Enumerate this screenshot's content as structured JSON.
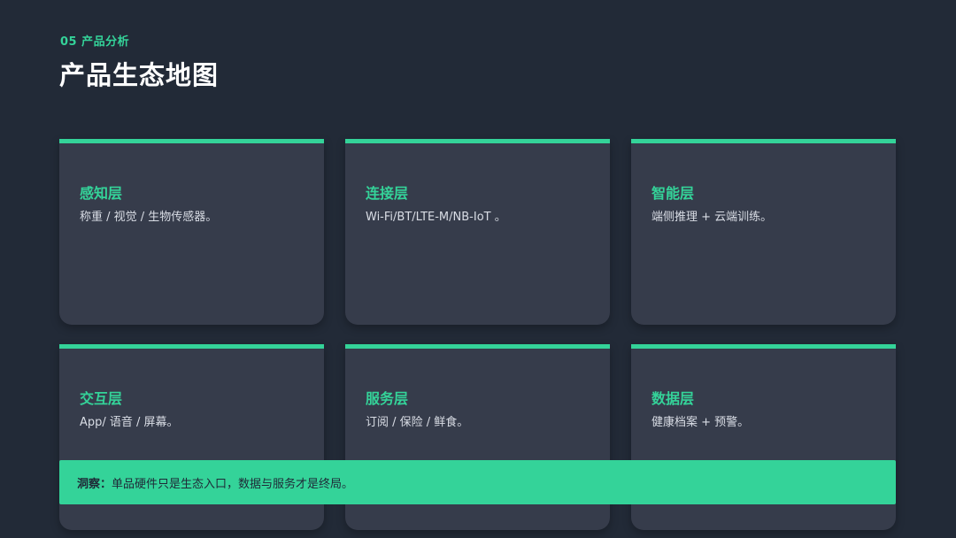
{
  "header": {
    "section": "05 产品分析",
    "title": "产品生态地图"
  },
  "cards": [
    {
      "title": "感知层",
      "desc": "称重 / 视觉 / 生物传感器。"
    },
    {
      "title": "连接层",
      "desc": "Wi-Fi/BT/LTE-M/NB-IoT 。"
    },
    {
      "title": "智能层",
      "desc": "端侧推理 + 云端训练。"
    },
    {
      "title": "交互层",
      "desc": "App/ 语音 / 屏幕。"
    },
    {
      "title": "服务层",
      "desc": "订阅 / 保险 / 鲜食。"
    },
    {
      "title": "数据层",
      "desc": "健康档案 + 预警。"
    }
  ],
  "insight": {
    "label": "洞察：",
    "text": "单品硬件只是生态入口，数据与服务才是终局。"
  },
  "colors": {
    "background": "#222a37",
    "card": "#363c4b",
    "accent": "#34d399"
  }
}
